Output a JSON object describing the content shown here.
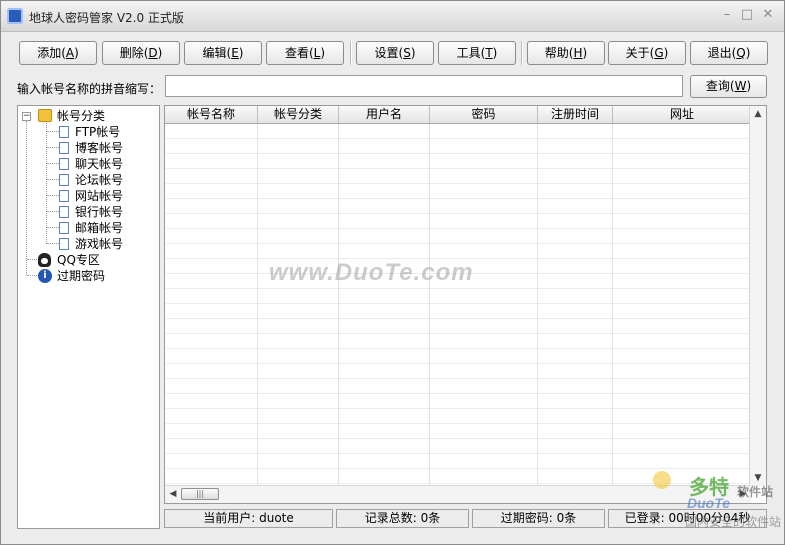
{
  "window": {
    "title": "地球人密码管家 V2.0 正式版"
  },
  "toolbar": [
    {
      "id": "add",
      "label": "添加(",
      "key": "A"
    },
    {
      "id": "delete",
      "label": "删除(",
      "key": "D"
    },
    {
      "id": "edit",
      "label": "编辑(",
      "key": "E"
    },
    {
      "id": "view",
      "label": "查看(",
      "key": "L"
    },
    {
      "id": "settings",
      "label": "设置(",
      "key": "S"
    },
    {
      "id": "tools",
      "label": "工具(",
      "key": "T"
    },
    {
      "id": "help",
      "label": "帮助(",
      "key": "H"
    },
    {
      "id": "about",
      "label": "关于(",
      "key": "G"
    },
    {
      "id": "exit",
      "label": "退出(",
      "key": "Q"
    }
  ],
  "search": {
    "label": "输入帐号名称的拼音缩写：",
    "value": "",
    "button_label": "查询(",
    "button_key": "W"
  },
  "tree": {
    "root": "帐号分类",
    "children": [
      "FTP帐号",
      "博客帐号",
      "聊天帐号",
      "论坛帐号",
      "网站帐号",
      "银行帐号",
      "邮箱帐号",
      "游戏帐号"
    ],
    "qq": "QQ专区",
    "expired": "过期密码"
  },
  "table": {
    "columns": [
      "帐号名称",
      "帐号分类",
      "用户名",
      "密码",
      "注册时间",
      "网址"
    ]
  },
  "statusbar": {
    "current_user": "当前用户: duote",
    "total_records": "记录总数: 0条",
    "expired": "过期密码: 0条",
    "logged_in": "已登录: 00时00分04秒"
  },
  "watermark": {
    "site": "www.DuoTe.com",
    "logo_cn": "多特",
    "logo_sub": "软件站",
    "logo_en": "DuoTe",
    "logo_foot": "国内安全的软件站"
  }
}
